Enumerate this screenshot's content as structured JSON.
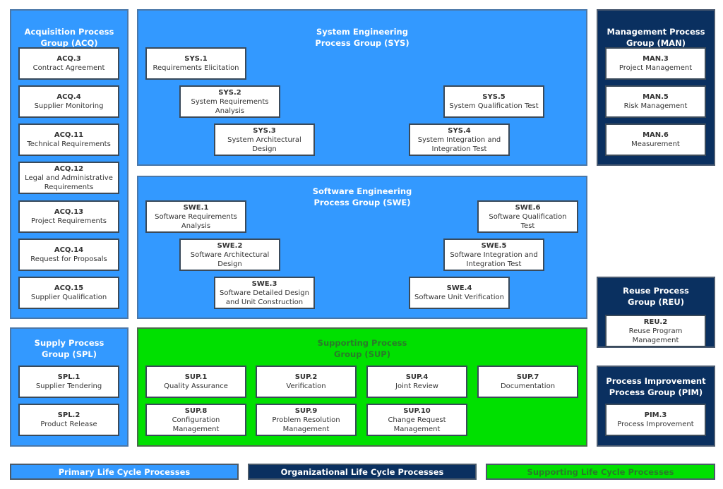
{
  "colors": {
    "primary": "#3399ff",
    "organizational": "#0a3060",
    "supporting": "#00e000",
    "supporting_text": "#2a7a2a"
  },
  "groups": [
    {
      "id": "acq",
      "kind": "primary",
      "title": "Acquisition Process\nGroup (ACQ)",
      "items": [
        {
          "code": "ACQ.3",
          "name": "Contract Agreement"
        },
        {
          "code": "ACQ.4",
          "name": "Supplier Monitoring"
        },
        {
          "code": "ACQ.11",
          "name": "Technical Requirements"
        },
        {
          "code": "ACQ.12",
          "name": "Legal and Administrative Requirements"
        },
        {
          "code": "ACQ.13",
          "name": "Project Requirements"
        },
        {
          "code": "ACQ.14",
          "name": "Request for Proposals"
        },
        {
          "code": "ACQ.15",
          "name": "Supplier Qualification"
        }
      ]
    },
    {
      "id": "sys",
      "kind": "primary",
      "title": "System Engineering\nProcess Group (SYS)",
      "items": [
        {
          "code": "SYS.1",
          "name": "Requirements Elicitation"
        },
        {
          "code": "SYS.2",
          "name": "System Requirements Analysis"
        },
        {
          "code": "SYS.3",
          "name": "System Architectural Design"
        },
        {
          "code": "SYS.4",
          "name": "System Integration and Integration Test"
        },
        {
          "code": "SYS.5",
          "name": "System Qualification Test"
        }
      ]
    },
    {
      "id": "man",
      "kind": "org",
      "title": "Management Process\nGroup (MAN)",
      "items": [
        {
          "code": "MAN.3",
          "name": "Project Management"
        },
        {
          "code": "MAN.5",
          "name": "Risk Management"
        },
        {
          "code": "MAN.6",
          "name": "Measurement"
        }
      ]
    },
    {
      "id": "swe",
      "kind": "primary",
      "title": "Software Engineering\nProcess Group (SWE)",
      "items": [
        {
          "code": "SWE.1",
          "name": "Software Requirements Analysis"
        },
        {
          "code": "SWE.2",
          "name": "Software Architectural Design"
        },
        {
          "code": "SWE.3",
          "name": "Software Detailed Design and Unit Construction"
        },
        {
          "code": "SWE.4",
          "name": "Software Unit Verification"
        },
        {
          "code": "SWE.5",
          "name": "Software Integration and Integration Test"
        },
        {
          "code": "SWE.6",
          "name": "Software Qualification Test"
        }
      ]
    },
    {
      "id": "reu",
      "kind": "org",
      "title": "Reuse Process\nGroup (REU)",
      "items": [
        {
          "code": "REU.2",
          "name": "Reuse Program Management"
        }
      ]
    },
    {
      "id": "spl",
      "kind": "primary",
      "title": "Supply Process\nGroup (SPL)",
      "items": [
        {
          "code": "SPL.1",
          "name": "Supplier Tendering"
        },
        {
          "code": "SPL.2",
          "name": "Product Release"
        }
      ]
    },
    {
      "id": "sup",
      "kind": "support",
      "title": "Supporting Process\nGroup (SUP)",
      "items": [
        {
          "code": "SUP.1",
          "name": "Quality Assurance"
        },
        {
          "code": "SUP.2",
          "name": "Verification"
        },
        {
          "code": "SUP.4",
          "name": "Joint Review"
        },
        {
          "code": "SUP.7",
          "name": "Documentation"
        },
        {
          "code": "SUP.8",
          "name": "Configuration Management"
        },
        {
          "code": "SUP.9",
          "name": "Problem Resolution Management"
        },
        {
          "code": "SUP.10",
          "name": "Change Request Management"
        }
      ]
    },
    {
      "id": "pim",
      "kind": "org",
      "title": "Process Improvement\nProcess Group (PIM)",
      "items": [
        {
          "code": "PIM.3",
          "name": "Process Improvement"
        }
      ]
    }
  ],
  "legend": [
    {
      "kind": "primary",
      "label": "Primary Life Cycle Processes"
    },
    {
      "kind": "org",
      "label": "Organizational Life Cycle Processes"
    },
    {
      "kind": "support",
      "label": "Supporting Life Cycle Processes"
    }
  ]
}
